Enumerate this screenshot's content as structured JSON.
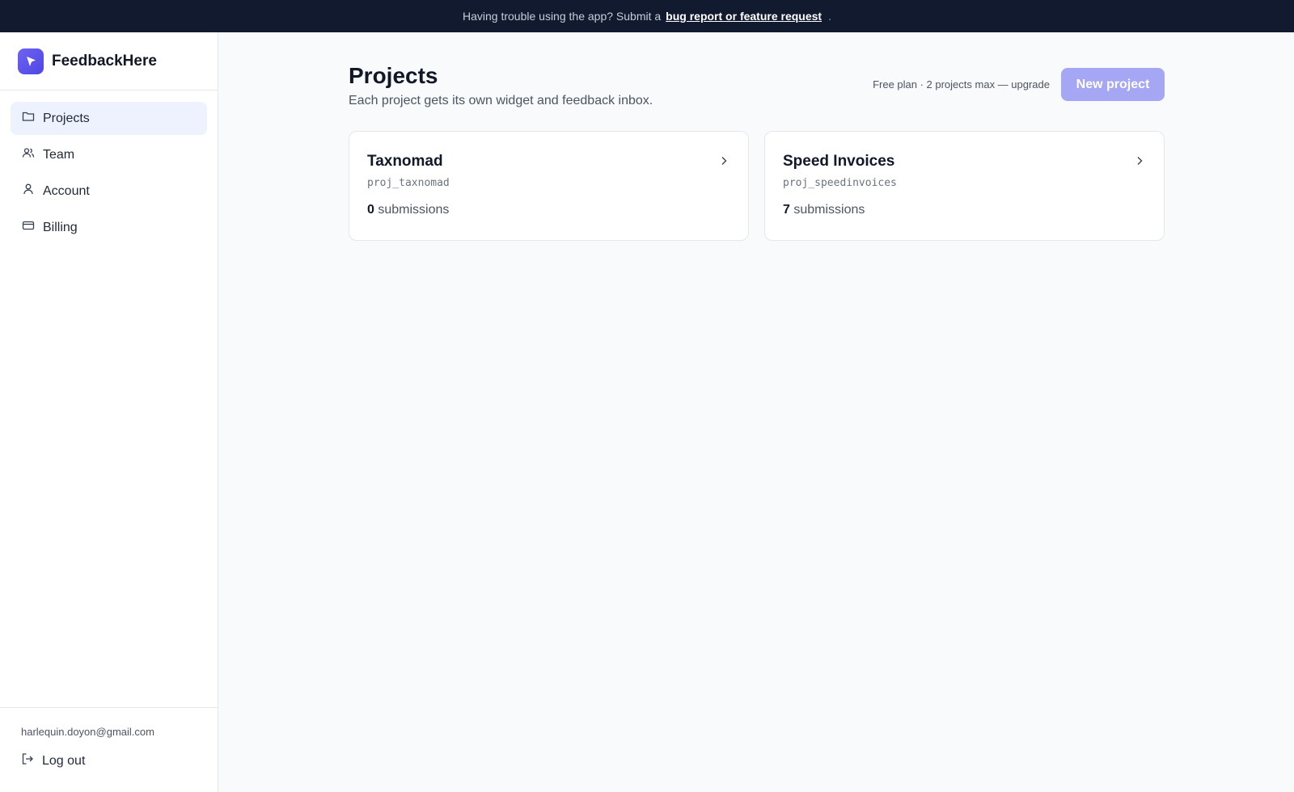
{
  "banner": {
    "text": "Having trouble using the app? Submit a",
    "link": "bug report or feature request",
    "suffix": "."
  },
  "brand": {
    "name": "FeedbackHere",
    "accent": "#4f46e5"
  },
  "sidebar": {
    "items": [
      {
        "label": "Projects",
        "icon": "folder-icon",
        "active": true
      },
      {
        "label": "Team",
        "icon": "users-icon",
        "active": false
      },
      {
        "label": "Account",
        "icon": "user-icon",
        "active": false
      },
      {
        "label": "Billing",
        "icon": "credit-card-icon",
        "active": false
      }
    ],
    "email": "harlequin.doyon@gmail.com",
    "logout": "Log out"
  },
  "page": {
    "title": "Projects",
    "subtitle": "Each project gets its own widget and feedback inbox.",
    "plan_text": "Free plan · 2 projects max — upgrade",
    "new_button": "New project"
  },
  "projects": [
    {
      "name": "Taxnomad",
      "id": "proj_taxnomad",
      "count": "0",
      "count_label": "submissions"
    },
    {
      "name": "Speed Invoices",
      "id": "proj_speedinvoices",
      "count": "7",
      "count_label": "submissions"
    }
  ]
}
